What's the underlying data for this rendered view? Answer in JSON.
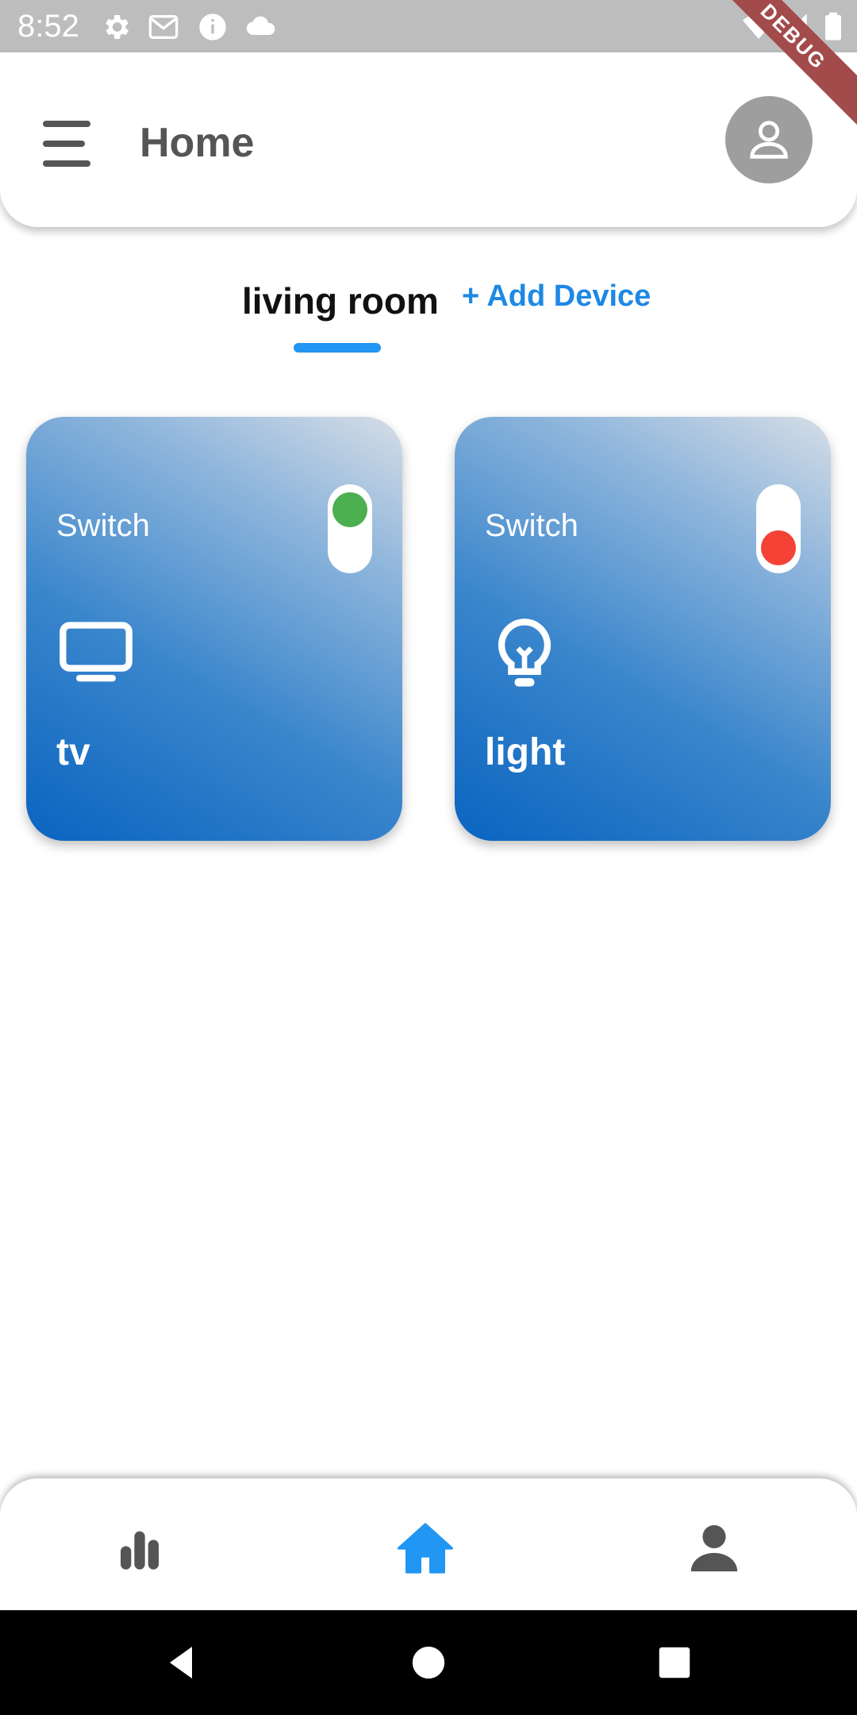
{
  "status_bar": {
    "time": "8:52",
    "debug_label": "DEBUG",
    "icons": [
      "settings-icon",
      "gmail-icon",
      "info-icon",
      "cloud-icon",
      "wifi-icon",
      "signal-icon",
      "battery-icon"
    ]
  },
  "app_bar": {
    "title": "Home",
    "menu_icon": "menu-icon",
    "avatar_icon": "person-icon"
  },
  "tabs": {
    "active": "living room",
    "add_device": "+ Add Device"
  },
  "devices": [
    {
      "label": "Switch",
      "name": "tv",
      "icon": "tv-icon",
      "state": "on",
      "knob_color": "#4caf50"
    },
    {
      "label": "Switch",
      "name": "light",
      "icon": "lightbulb-icon",
      "state": "off",
      "knob_color": "#f44336"
    }
  ],
  "bottom_nav": {
    "items": [
      {
        "icon": "bar-chart-icon",
        "active": false
      },
      {
        "icon": "home-icon",
        "active": true
      },
      {
        "icon": "person-icon",
        "active": false
      }
    ],
    "active_color": "#2196f3",
    "inactive_color": "#555555"
  },
  "colors": {
    "accent": "#2196f3",
    "card_gradient_start": "#0a64c0",
    "card_gradient_end": "#d6dde6"
  }
}
